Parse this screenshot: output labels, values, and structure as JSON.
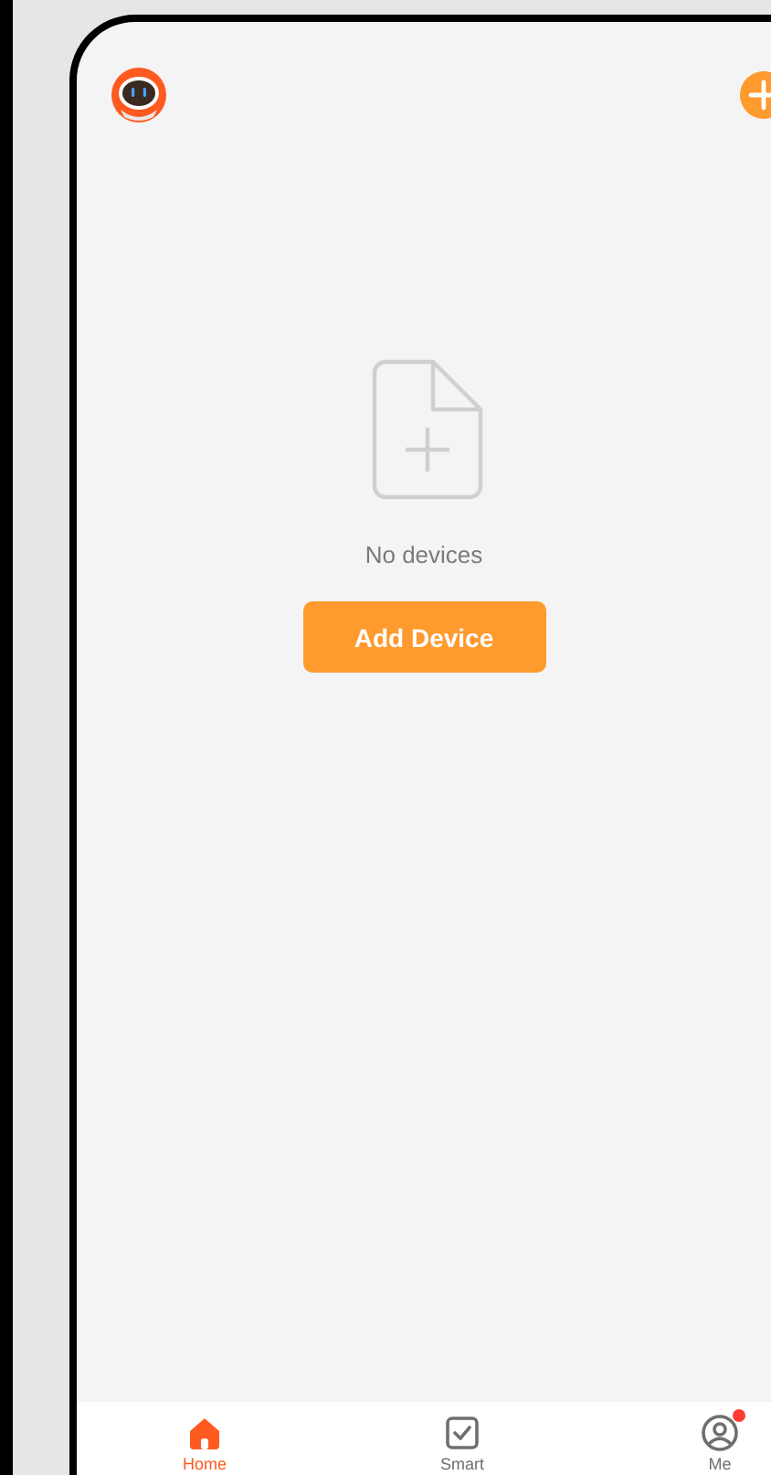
{
  "empty_state": {
    "message": "No devices",
    "button": "Add Device"
  },
  "tabs": [
    {
      "label": "Home",
      "kind": "home",
      "selected": true,
      "badge": false
    },
    {
      "label": "Smart",
      "kind": "smart",
      "selected": false,
      "badge": false
    },
    {
      "label": "Me",
      "kind": "me",
      "selected": false,
      "badge": true
    }
  ]
}
